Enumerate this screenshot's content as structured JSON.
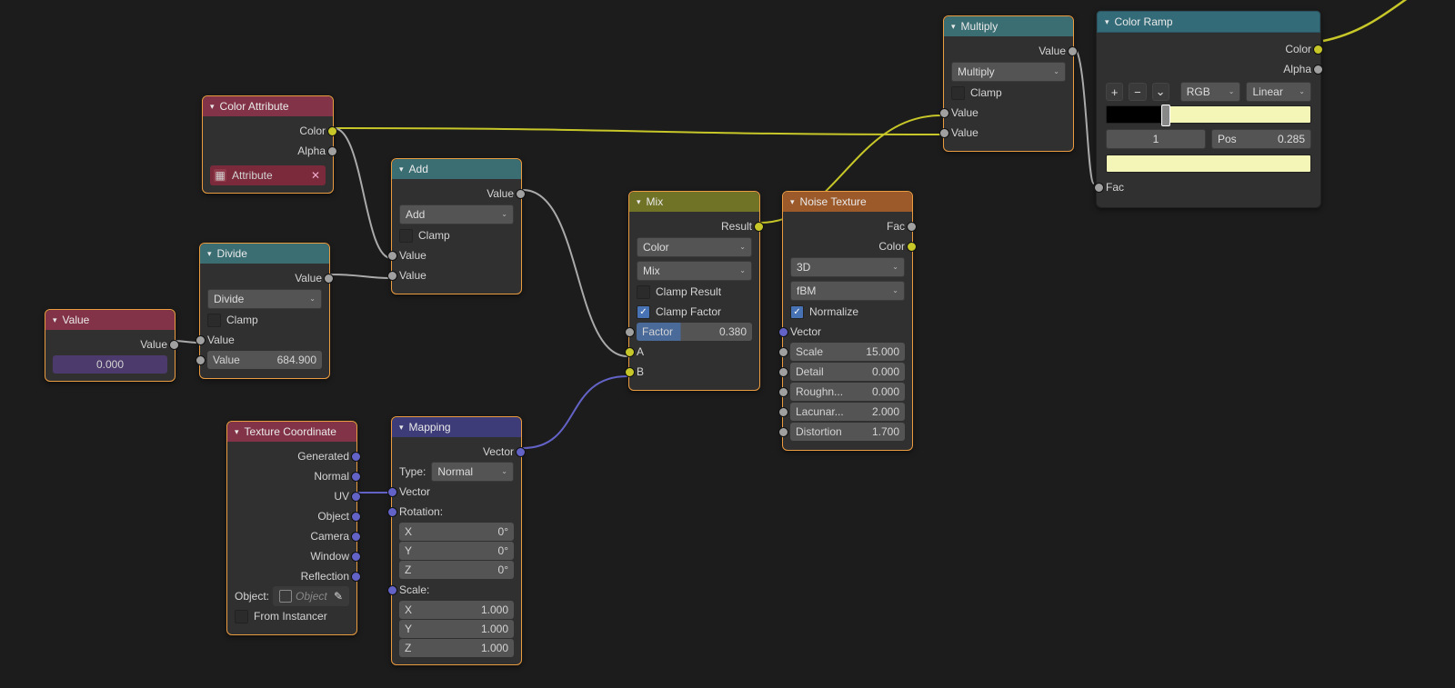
{
  "color_attribute": {
    "title": "Color Attribute",
    "out_color": "Color",
    "out_alpha": "Alpha",
    "attribute_btn": "Attribute"
  },
  "value_node": {
    "title": "Value",
    "out": "Value",
    "value": "0.000"
  },
  "divide": {
    "title": "Divide",
    "out": "Value",
    "op": "Divide",
    "clamp": "Clamp",
    "in1": "Value",
    "in1_field": {
      "label": "Value",
      "value": "684.900"
    }
  },
  "add": {
    "title": "Add",
    "out": "Value",
    "op": "Add",
    "clamp": "Clamp",
    "in1": "Value",
    "in2": "Value"
  },
  "mix": {
    "title": "Mix",
    "out": "Result",
    "data_type": "Color",
    "blend": "Mix",
    "clamp_result": "Clamp Result",
    "clamp_factor": "Clamp Factor",
    "factor": {
      "label": "Factor",
      "value": "0.380"
    },
    "a": "A",
    "b": "B"
  },
  "noise": {
    "title": "Noise Texture",
    "out_fac": "Fac",
    "out_color": "Color",
    "dim": "3D",
    "type": "fBM",
    "normalize": "Normalize",
    "vector": "Vector",
    "scale": {
      "label": "Scale",
      "value": "15.000"
    },
    "detail": {
      "label": "Detail",
      "value": "0.000"
    },
    "rough": {
      "label": "Roughn...",
      "value": "0.000"
    },
    "lacu": {
      "label": "Lacunar...",
      "value": "2.000"
    },
    "dist": {
      "label": "Distortion",
      "value": "1.700"
    }
  },
  "multiply": {
    "title": "Multiply",
    "out": "Value",
    "op": "Multiply",
    "clamp": "Clamp",
    "in1": "Value",
    "in2": "Value"
  },
  "texcoord": {
    "title": "Texture Coordinate",
    "outs": [
      "Generated",
      "Normal",
      "UV",
      "Object",
      "Camera",
      "Window",
      "Reflection"
    ],
    "object_label": "Object:",
    "object_field": "Object",
    "from_inst": "From Instancer"
  },
  "mapping": {
    "title": "Mapping",
    "out": "Vector",
    "type_label": "Type:",
    "type": "Normal",
    "vector": "Vector",
    "rotation": "Rotation:",
    "scale": "Scale:",
    "rot": {
      "x": "0°",
      "y": "0°",
      "z": "0°"
    },
    "scl": {
      "x": "1.000",
      "y": "1.000",
      "z": "1.000"
    },
    "axes": {
      "x": "X",
      "y": "Y",
      "z": "Z"
    }
  },
  "color_ramp": {
    "title": "Color Ramp",
    "out_color": "Color",
    "out_alpha": "Alpha",
    "mode": "RGB",
    "interp": "Linear",
    "index": "1",
    "pos_label": "Pos",
    "pos": "0.285",
    "fac": "Fac"
  },
  "chart_data": null
}
